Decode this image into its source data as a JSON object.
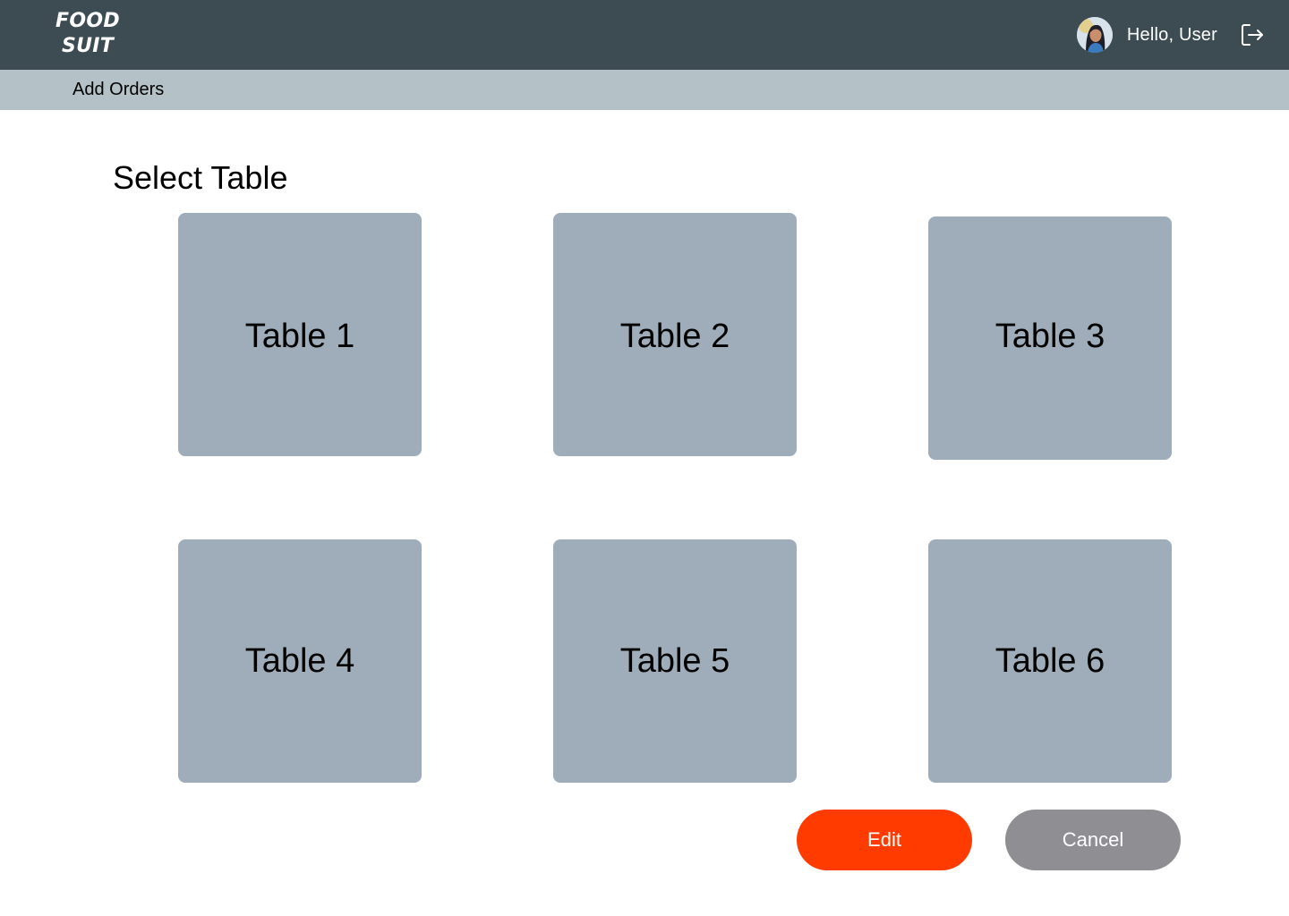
{
  "header": {
    "logo_line1": "FOOD",
    "logo_line2": "SUIT",
    "greeting": "Hello, User",
    "logout_icon": "logout-icon",
    "avatar_icon": "user-avatar"
  },
  "subnav": {
    "label": "Add Orders"
  },
  "main": {
    "title": "Select Table",
    "tables": [
      {
        "label": "Table 1"
      },
      {
        "label": "Table 2"
      },
      {
        "label": "Table 3"
      },
      {
        "label": "Table 4"
      },
      {
        "label": "Table 5"
      },
      {
        "label": "Table 6"
      }
    ]
  },
  "actions": {
    "edit_label": "Edit",
    "cancel_label": "Cancel"
  },
  "colors": {
    "header_bg": "#3d4c53",
    "subbar_bg": "#b4c1c6",
    "card_bg": "#9eadb9",
    "edit_bg": "#ff3b00",
    "cancel_bg": "#8e8e93"
  }
}
